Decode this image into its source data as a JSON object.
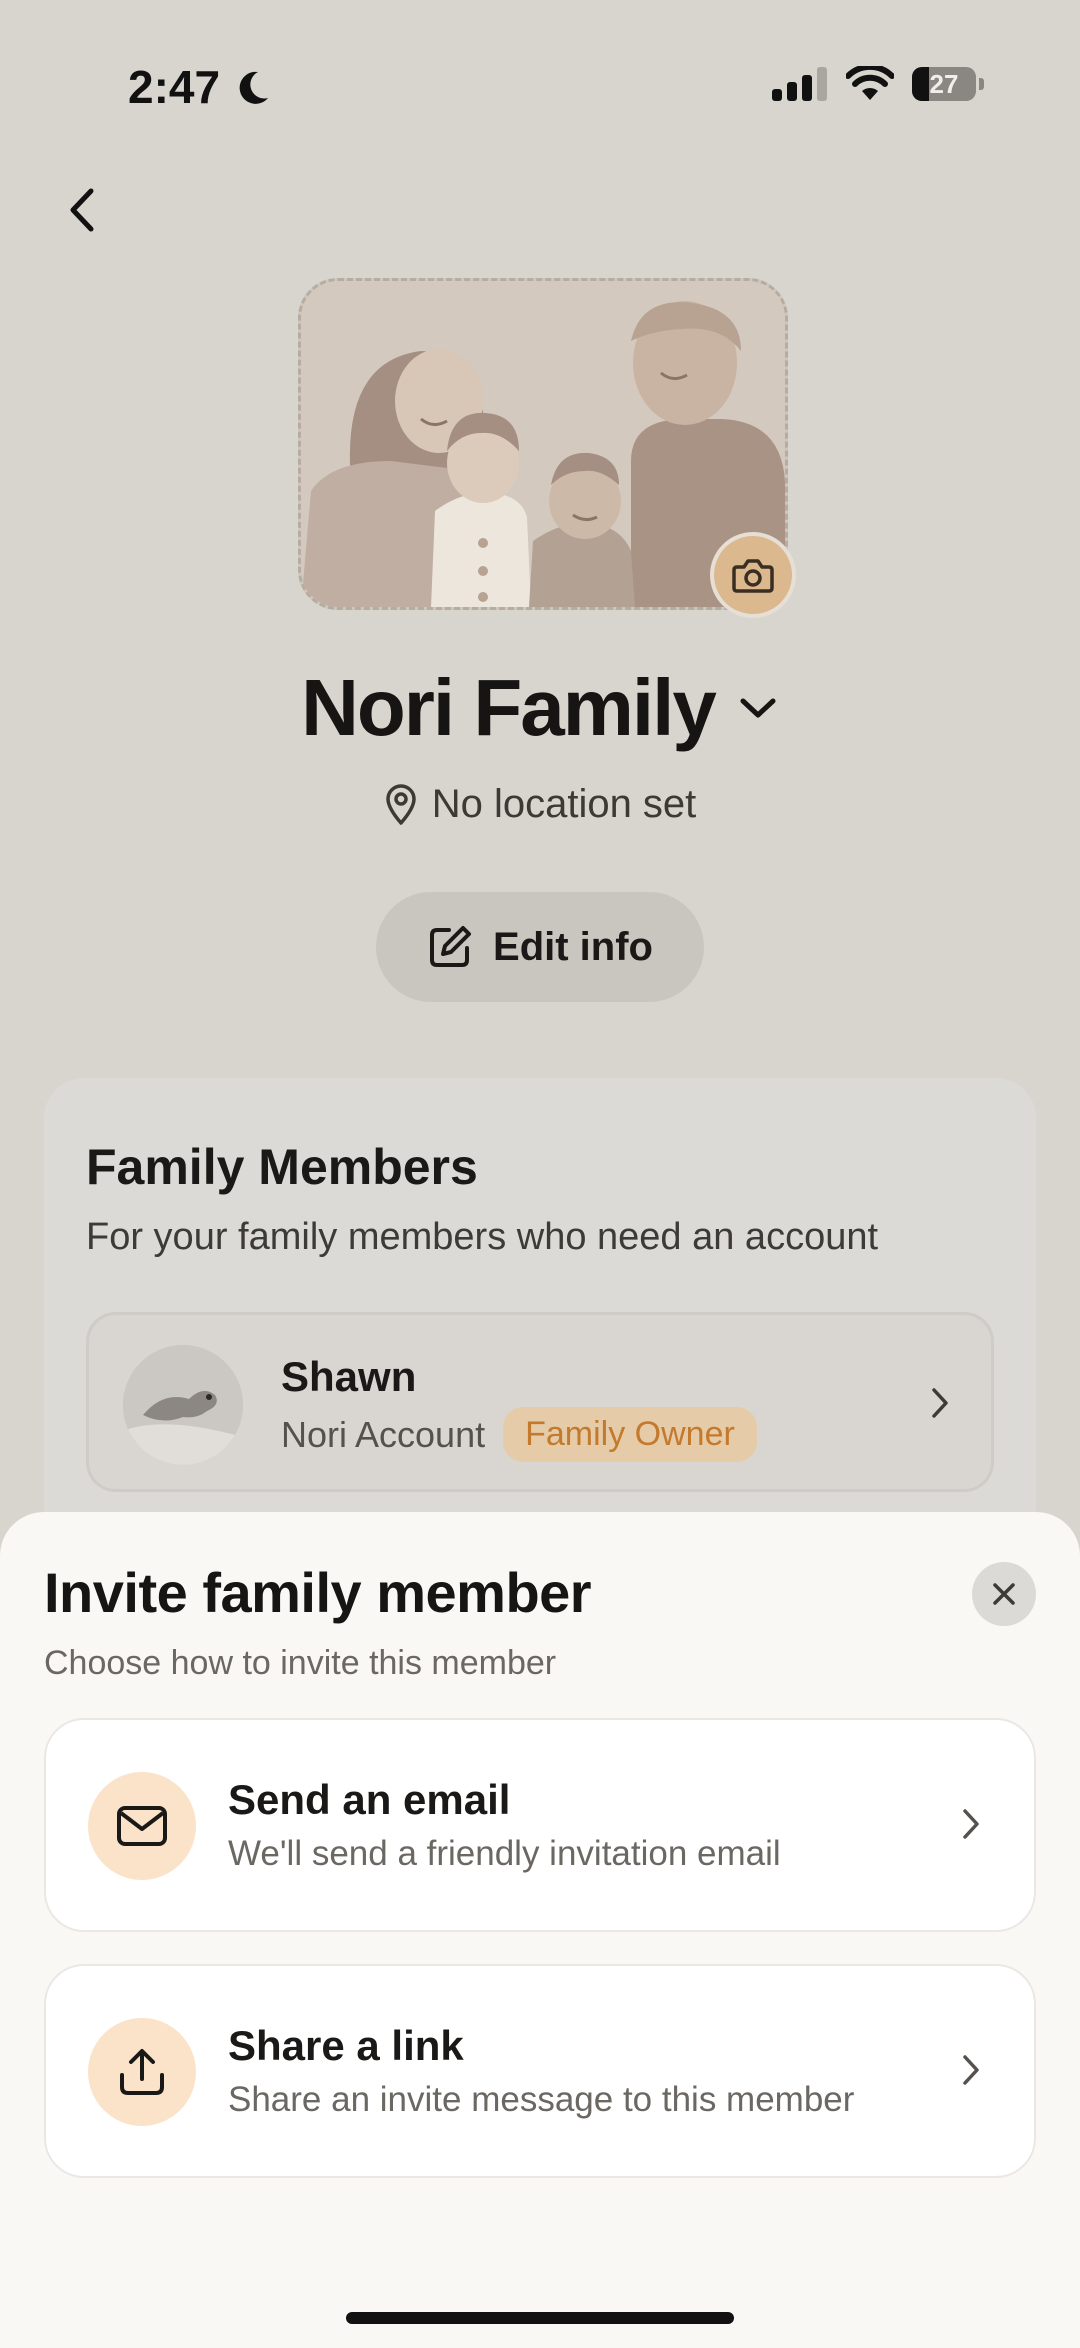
{
  "status_bar": {
    "time": "2:47",
    "battery_percent": "27",
    "battery_level": 0.27
  },
  "icons": {
    "back": "chevron-left-icon",
    "moon": "moon-icon",
    "signal": "cellular-signal-icon",
    "wifi": "wifi-icon",
    "camera": "camera-icon",
    "dropdown": "chevron-down-icon",
    "location": "location-pin-icon",
    "edit": "edit-square-icon",
    "close": "close-icon",
    "email": "envelope-icon",
    "share": "share-upload-icon"
  },
  "family": {
    "name": "Nori Family",
    "location": "No location set",
    "edit_label": "Edit info"
  },
  "members_card": {
    "title": "Family Members",
    "subtitle": "For your family members who need an account",
    "members": [
      {
        "name": "Shawn",
        "account": "Nori Account",
        "badge": "Family Owner"
      }
    ]
  },
  "invite_sheet": {
    "title": "Invite family member",
    "subtitle": "Choose how to invite this member",
    "options": [
      {
        "title": "Send an email",
        "description": "We'll send a friendly invitation email"
      },
      {
        "title": "Share a link",
        "description": "Share an invite message to this member"
      }
    ]
  },
  "colors": {
    "background": "#d8d4ce",
    "accent": "#dcb88f",
    "badge_text": "#c37a2c",
    "badge_bg": "#e6cba9",
    "sheet_bg": "#faf8f5",
    "option_icon_bg": "#fbe3c9"
  }
}
